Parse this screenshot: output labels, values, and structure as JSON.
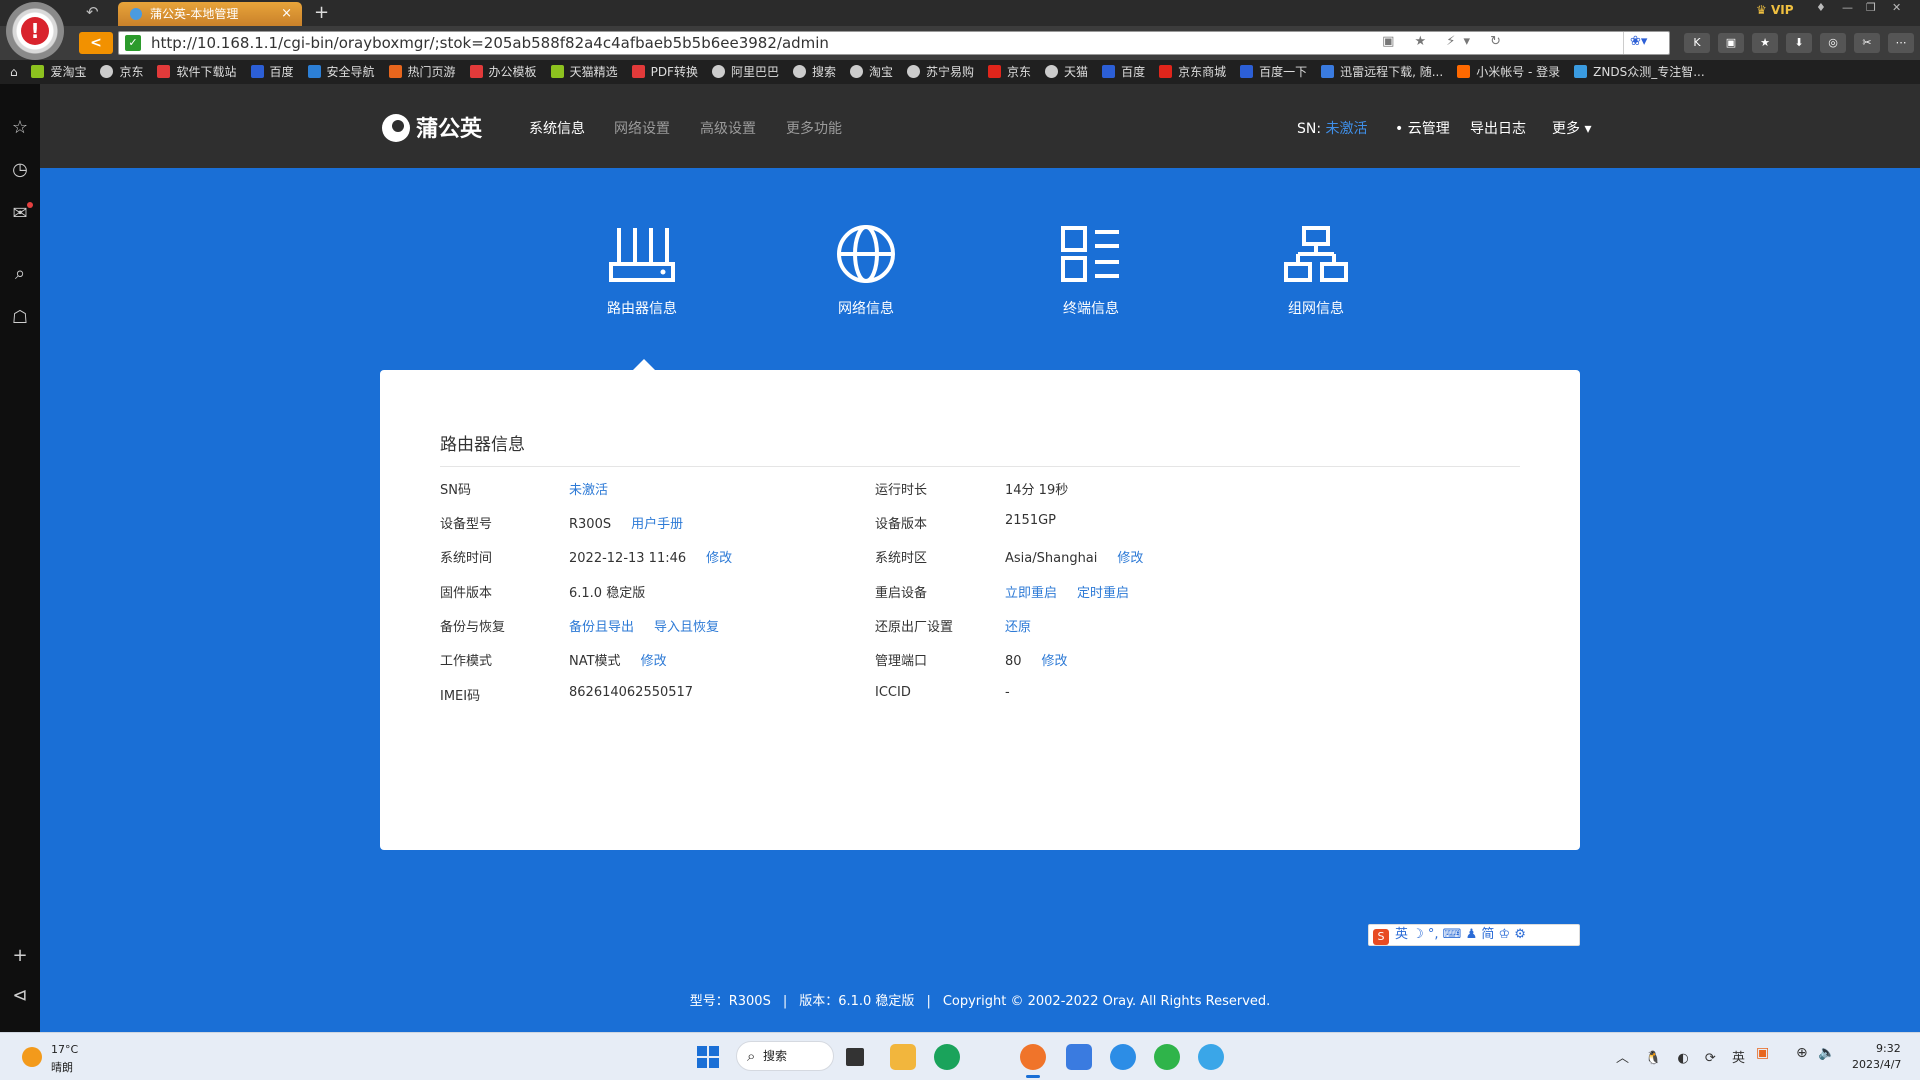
{
  "browser": {
    "tab_title": "蒲公英-本地管理",
    "url": "http://10.168.1.1/cgi-bin/orayboxmgr/;stok=205ab588f82a4c4afbaeb5b5b6ee3982/admin",
    "vip_label": "VIP",
    "bookmarks": [
      {
        "label": "爱淘宝",
        "icon": "leaf-icon",
        "color": "#8dc21f"
      },
      {
        "label": "京东",
        "icon": "globe-icon",
        "color": "#cccccc"
      },
      {
        "label": "软件下载站",
        "icon": "download-icon",
        "color": "#e23a3a"
      },
      {
        "label": "百度",
        "icon": "baidu-paw-icon",
        "color": "#2c5fd6"
      },
      {
        "label": "安全导航",
        "icon": "shield-icon",
        "color": "#2c7fd6"
      },
      {
        "label": "热门页游",
        "icon": "game-icon",
        "color": "#e8661d"
      },
      {
        "label": "办公模板",
        "icon": "template-icon",
        "color": "#e23a3a"
      },
      {
        "label": "天猫精选",
        "icon": "leaf-icon",
        "color": "#8dc21f"
      },
      {
        "label": "PDF转换",
        "icon": "pdf-icon",
        "color": "#e23a3a"
      },
      {
        "label": "阿里巴巴",
        "icon": "globe-icon",
        "color": "#cccccc"
      },
      {
        "label": "搜索",
        "icon": "globe-icon",
        "color": "#cccccc"
      },
      {
        "label": "淘宝",
        "icon": "globe-icon",
        "color": "#cccccc"
      },
      {
        "label": "苏宁易购",
        "icon": "globe-icon",
        "color": "#cccccc"
      },
      {
        "label": "京东",
        "icon": "jd-icon",
        "color": "#e1251b"
      },
      {
        "label": "天猫",
        "icon": "globe-icon",
        "color": "#cccccc"
      },
      {
        "label": "百度",
        "icon": "baidu-paw-icon",
        "color": "#2c5fd6"
      },
      {
        "label": "京东商城",
        "icon": "jd-icon",
        "color": "#e1251b"
      },
      {
        "label": "百度一下",
        "icon": "baidu-paw-icon",
        "color": "#2c5fd6"
      },
      {
        "label": "迅雷远程下载, 随...",
        "icon": "thunder-icon",
        "color": "#3a7be0"
      },
      {
        "label": "小米帐号 - 登录",
        "icon": "mi-icon",
        "color": "#ff6900"
      },
      {
        "label": "ZNDS众测_专注智...",
        "icon": "znds-icon",
        "color": "#3a9be0"
      }
    ]
  },
  "router": {
    "logo_text": "蒲公英",
    "nav": [
      {
        "label": "系统信息",
        "active": true
      },
      {
        "label": "网络设置",
        "active": false
      },
      {
        "label": "高级设置",
        "active": false
      },
      {
        "label": "更多功能",
        "active": false
      }
    ],
    "sn_label": "SN:",
    "sn_value": "未激活",
    "cloud_manage": "云管理",
    "export_log": "导出日志",
    "more": "更多",
    "categories": [
      {
        "label": "路由器信息",
        "icon": "router-icon"
      },
      {
        "label": "网络信息",
        "icon": "globe-network-icon"
      },
      {
        "label": "终端信息",
        "icon": "terminal-list-icon"
      },
      {
        "label": "组网信息",
        "icon": "network-topology-icon"
      }
    ],
    "card_title": "路由器信息",
    "left_rows": [
      {
        "label": "SN码",
        "value": "",
        "links": [
          "未激活"
        ]
      },
      {
        "label": "设备型号",
        "value": "R300S",
        "links": [
          "用户手册"
        ]
      },
      {
        "label": "系统时间",
        "value": "2022-12-13 11:46",
        "links": [
          "修改"
        ]
      },
      {
        "label": "固件版本",
        "value": "6.1.0 稳定版",
        "links": []
      },
      {
        "label": "备份与恢复",
        "value": "",
        "links": [
          "备份且导出",
          "导入且恢复"
        ]
      },
      {
        "label": "工作模式",
        "value": "NAT模式",
        "links": [
          "修改"
        ]
      },
      {
        "label": "IMEI码",
        "value": "862614062550517",
        "links": []
      }
    ],
    "right_rows": [
      {
        "label": "运行时长",
        "value": "14分 19秒",
        "links": []
      },
      {
        "label": "设备版本",
        "value": "2151GP",
        "links": []
      },
      {
        "label": "系统时区",
        "value": "Asia/Shanghai",
        "links": [
          "修改"
        ]
      },
      {
        "label": "重启设备",
        "value": "",
        "links": [
          "立即重启",
          "定时重启"
        ]
      },
      {
        "label": "还原出厂设置",
        "value": "",
        "links": [
          "还原"
        ]
      },
      {
        "label": "管理端口",
        "value": "80",
        "links": [
          "修改"
        ]
      },
      {
        "label": "ICCID",
        "value": "-",
        "links": []
      }
    ],
    "footer": {
      "model": "型号：R300S",
      "version": "版本：6.1.0 稳定版",
      "copyright": "Copyright © 2002-2022 Oray. All Rights Reserved."
    }
  },
  "ime": {
    "items": "英 ☽ °, ⌨ ♟ 简 ♔ ⚙"
  },
  "taskbar": {
    "weather_temp": "17°C",
    "weather_desc": "晴朗",
    "search_label": "搜索",
    "clock_time": "9:32",
    "clock_date": "2023/4/7",
    "tray_icons": "︿ 🐧 ◐ ⟳ 英"
  },
  "colors": {
    "page_bg": "#1a6fd6",
    "topnav_bg": "#2f2f2f",
    "link": "#2d7ad6",
    "sn_highlight": "#3f8fe8"
  }
}
